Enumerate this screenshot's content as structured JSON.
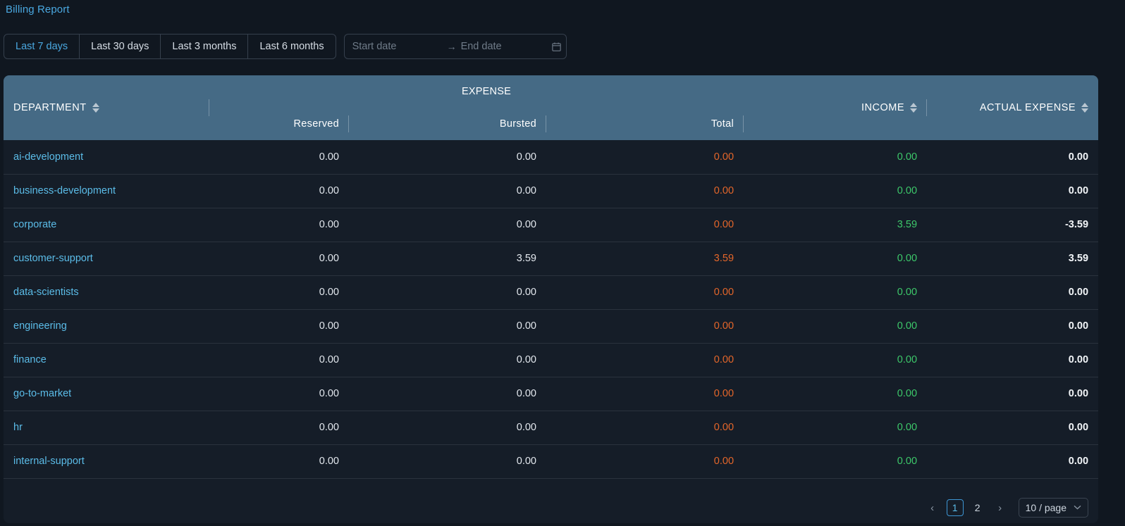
{
  "header": {
    "title": "Billing Report"
  },
  "toolbar": {
    "ranges": [
      {
        "label": "Last 7 days",
        "active": true
      },
      {
        "label": "Last 30 days",
        "active": false
      },
      {
        "label": "Last 3 months",
        "active": false
      },
      {
        "label": "Last 6 months",
        "active": false
      }
    ],
    "date_range": {
      "start_placeholder": "Start date",
      "start_value": "",
      "end_placeholder": "End date",
      "end_value": "",
      "separator": "→",
      "calendar_icon": "calendar-icon"
    }
  },
  "table": {
    "group_header": "EXPENSE",
    "columns": {
      "department": "DEPARTMENT",
      "reserved": "Reserved",
      "bursted": "Bursted",
      "total": "Total",
      "income": "INCOME",
      "actual_expense": "ACTUAL EXPENSE"
    },
    "sort_icon": "sort-updown-icon",
    "rows": [
      {
        "department": "ai-development",
        "reserved": "0.00",
        "bursted": "0.00",
        "total": "0.00",
        "income": "0.00",
        "actual_expense": "0.00"
      },
      {
        "department": "business-development",
        "reserved": "0.00",
        "bursted": "0.00",
        "total": "0.00",
        "income": "0.00",
        "actual_expense": "0.00"
      },
      {
        "department": "corporate",
        "reserved": "0.00",
        "bursted": "0.00",
        "total": "0.00",
        "income": "3.59",
        "actual_expense": "-3.59"
      },
      {
        "department": "customer-support",
        "reserved": "0.00",
        "bursted": "3.59",
        "total": "3.59",
        "income": "0.00",
        "actual_expense": "3.59"
      },
      {
        "department": "data-scientists",
        "reserved": "0.00",
        "bursted": "0.00",
        "total": "0.00",
        "income": "0.00",
        "actual_expense": "0.00"
      },
      {
        "department": "engineering",
        "reserved": "0.00",
        "bursted": "0.00",
        "total": "0.00",
        "income": "0.00",
        "actual_expense": "0.00"
      },
      {
        "department": "finance",
        "reserved": "0.00",
        "bursted": "0.00",
        "total": "0.00",
        "income": "0.00",
        "actual_expense": "0.00"
      },
      {
        "department": "go-to-market",
        "reserved": "0.00",
        "bursted": "0.00",
        "total": "0.00",
        "income": "0.00",
        "actual_expense": "0.00"
      },
      {
        "department": "hr",
        "reserved": "0.00",
        "bursted": "0.00",
        "total": "0.00",
        "income": "0.00",
        "actual_expense": "0.00"
      },
      {
        "department": "internal-support",
        "reserved": "0.00",
        "bursted": "0.00",
        "total": "0.00",
        "income": "0.00",
        "actual_expense": "0.00"
      }
    ]
  },
  "pagination": {
    "prev_label": "‹",
    "next_label": "›",
    "pages": [
      {
        "label": "1",
        "active": true
      },
      {
        "label": "2",
        "active": false
      }
    ],
    "page_size_label": "10 / page",
    "chevron": "⌄"
  },
  "colors": {
    "accent_link": "#5bbce8",
    "header_bg": "#456a85",
    "total_expense": "#e4662a",
    "income": "#3dc86a",
    "page_bg": "#101720",
    "table_bg": "#151d28"
  }
}
